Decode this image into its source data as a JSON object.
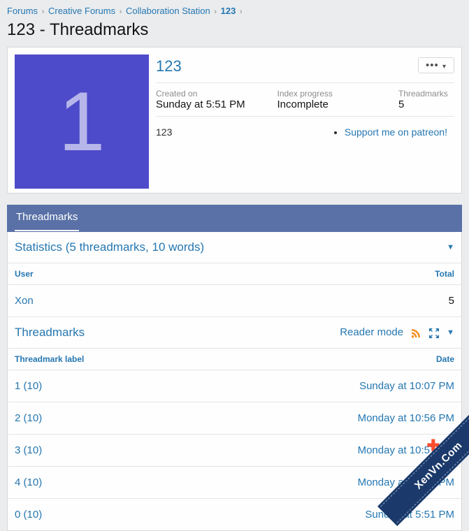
{
  "breadcrumb": [
    {
      "label": "Forums",
      "bold": false
    },
    {
      "label": "Creative Forums",
      "bold": false
    },
    {
      "label": "Collaboration Station",
      "bold": false
    },
    {
      "label": "123",
      "bold": true
    }
  ],
  "page_title": "123 - Threadmarks",
  "thread": {
    "avatar_letter": "1",
    "title": "123",
    "more_button": "•••",
    "meta": {
      "created_label": "Created on",
      "created_value": "Sunday at 5:51 PM",
      "progress_label": "Index progress",
      "progress_value": "Incomplete",
      "tm_label": "Threadmarks",
      "tm_value": "5"
    },
    "description": "123",
    "support_link": "Support me on patreon!"
  },
  "tabs": {
    "threadmarks": "Threadmarks"
  },
  "stats": {
    "header": "Statistics (5 threadmarks, 10 words)",
    "col_user": "User",
    "col_total": "Total",
    "rows": [
      {
        "user": "Xon",
        "total": "5"
      }
    ]
  },
  "threadmarks_section": {
    "title": "Threadmarks",
    "reader_mode": "Reader mode",
    "col_label": "Threadmark label",
    "col_date": "Date",
    "rows": [
      {
        "label": "1 (10)",
        "date": "Sunday at 10:07 PM"
      },
      {
        "label": "2 (10)",
        "date": "Monday at 10:56 PM"
      },
      {
        "label": "3 (10)",
        "date": "Monday at 10:57 PM"
      },
      {
        "label": "4 (10)",
        "date": "Monday at 10:57 PM"
      },
      {
        "label": "0 (10)",
        "date": "Sunday at 5:51 PM"
      }
    ]
  },
  "ribbon": "XenVn.Com"
}
